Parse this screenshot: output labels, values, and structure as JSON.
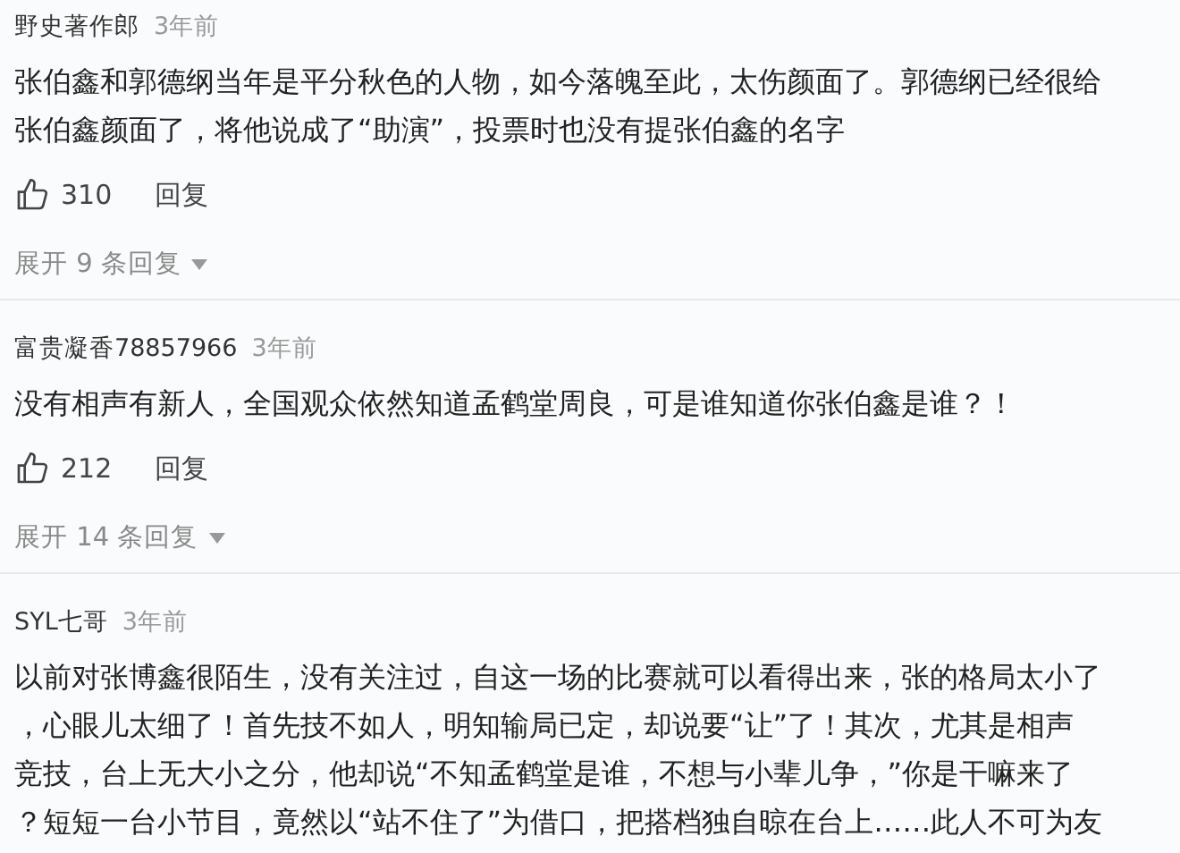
{
  "comments": [
    {
      "user": "野史著作郎",
      "time": "3年前",
      "lines": [
        "张伯鑫和郭德纲当年是平分秋色的人物，如今落魄至此，太伤颜面了。郭德纲已经很给",
        "张伯鑫颜面了，将他说成了“助演”，投票时也没有提张伯鑫的名字"
      ],
      "likes": "310",
      "reply": "回复",
      "expand": "展开 9 条回复"
    },
    {
      "user": "富贵凝香78857966",
      "time": "3年前",
      "lines": [
        "没有相声有新人，全国观众依然知道孟鹤堂周良，可是谁知道你张伯鑫是谁？！"
      ],
      "likes": "212",
      "reply": "回复",
      "expand": "展开 14 条回复"
    },
    {
      "user": "SYL七哥",
      "time": "3年前",
      "lines": [
        "以前对张博鑫很陌生，没有关注过，自这一场的比赛就可以看得出来，张的格局太小了",
        "，心眼儿太细了！首先技不如人，明知输局已定，却说要“让”了！其次，尤其是相声",
        "竞技，台上无大小之分，他却说“不知孟鹤堂是谁，不想与小辈儿争，”你是干嘛来了",
        "？短短一台小节目，竟然以“站不住了”为借口，把搭档独自晾在台上……此人不可为友"
      ]
    }
  ]
}
